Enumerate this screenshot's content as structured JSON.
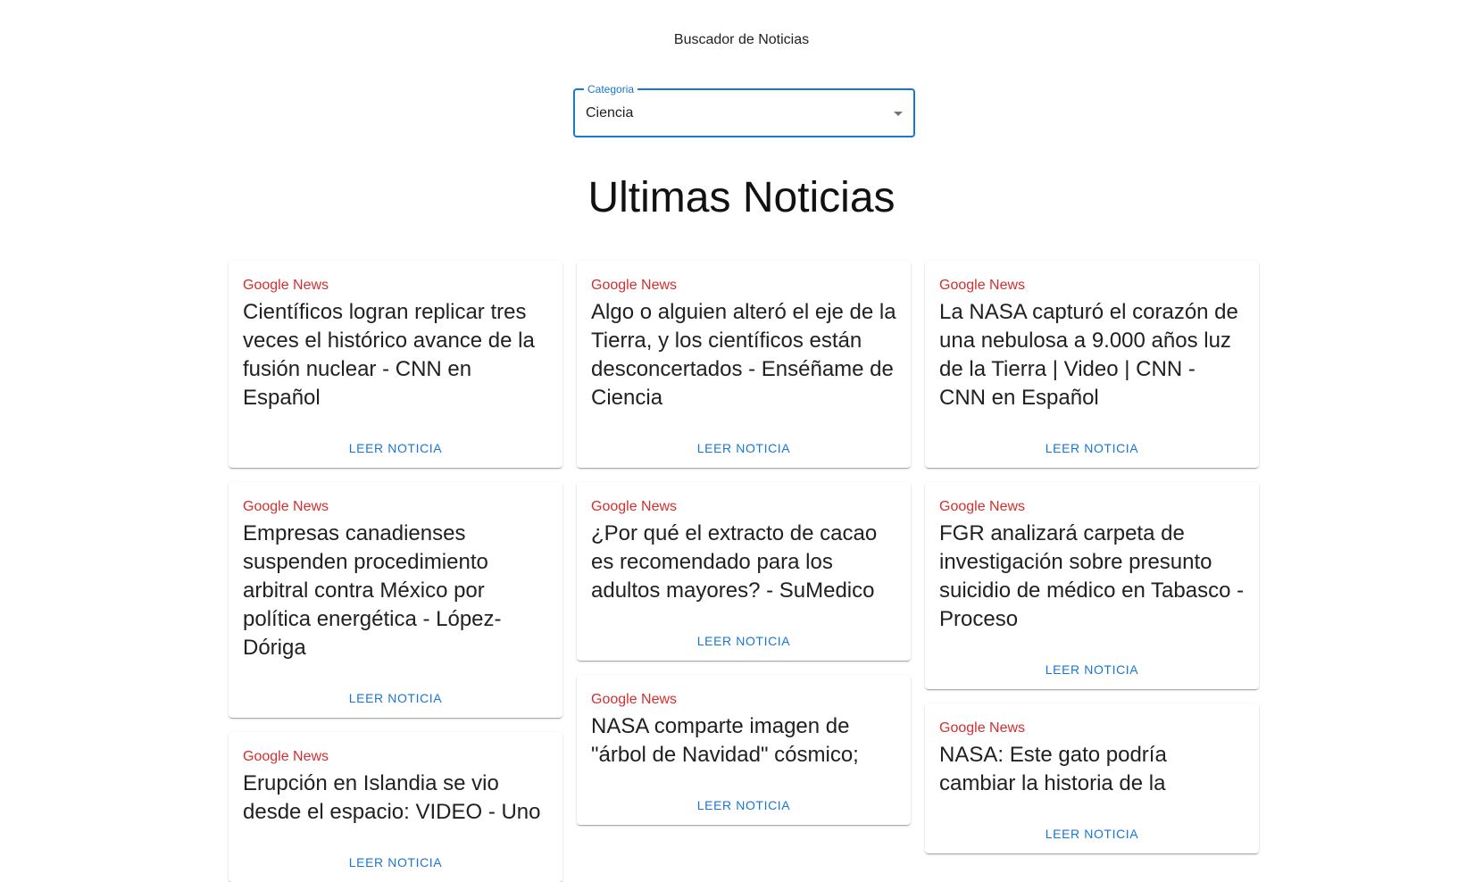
{
  "header": {
    "title": "Buscador de Noticias"
  },
  "category_select": {
    "label": "Categoria",
    "value": "Ciencia"
  },
  "section": {
    "heading": "Ultimas Noticias"
  },
  "news": [
    {
      "source": "Google News",
      "title": "Científicos logran replicar tres veces el histórico avance de la fusión nuclear - CNN en Español",
      "action": "Leer Noticia"
    },
    {
      "source": "Google News",
      "title": "Algo o alguien alteró el eje de la Tierra, y los científicos están desconcertados - Enséñame de Ciencia",
      "action": "Leer Noticia"
    },
    {
      "source": "Google News",
      "title": "La NASA capturó el corazón de una nebulosa a 9.000 años luz de la Tierra | Video | CNN - CNN en Español",
      "action": "Leer Noticia"
    },
    {
      "source": "Google News",
      "title": "Empresas canadienses suspenden procedimiento arbitral contra México por política energética - López-Dóriga",
      "action": "Leer Noticia"
    },
    {
      "source": "Google News",
      "title": "¿Por qué el extracto de cacao es recomendado para los adultos mayores? - SuMedico",
      "action": "Leer Noticia"
    },
    {
      "source": "Google News",
      "title": "FGR analizará carpeta de investigación sobre presunto suicidio de médico en Tabasco - Proceso",
      "action": "Leer Noticia"
    },
    {
      "source": "Google News",
      "title": "Erupción en Islandia se vio desde el espacio: VIDEO - Uno",
      "action": "Leer Noticia"
    },
    {
      "source": "Google News",
      "title": "NASA comparte imagen de \"árbol de Navidad\" cósmico;",
      "action": "Leer Noticia"
    },
    {
      "source": "Google News",
      "title": "NASA: Este gato podría cambiar la historia de la",
      "action": "Leer Noticia"
    }
  ]
}
